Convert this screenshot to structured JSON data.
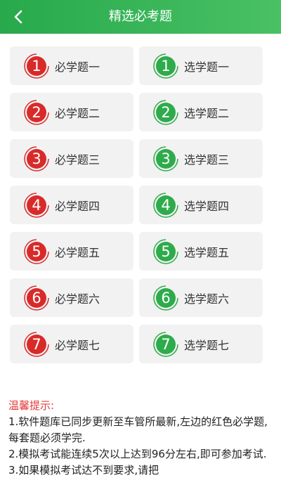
{
  "header": {
    "title": "精选必考题"
  },
  "required": [
    {
      "num": "1",
      "label": "必学题一"
    },
    {
      "num": "2",
      "label": "必学题二"
    },
    {
      "num": "3",
      "label": "必学题三"
    },
    {
      "num": "4",
      "label": "必学题四"
    },
    {
      "num": "5",
      "label": "必学题五"
    },
    {
      "num": "6",
      "label": "必学题六"
    },
    {
      "num": "7",
      "label": "必学题七"
    }
  ],
  "optional": [
    {
      "num": "1",
      "label": "选学题一"
    },
    {
      "num": "2",
      "label": "选学题二"
    },
    {
      "num": "3",
      "label": "选学题三"
    },
    {
      "num": "4",
      "label": "选学题四"
    },
    {
      "num": "5",
      "label": "选学题五"
    },
    {
      "num": "6",
      "label": "选学题六"
    },
    {
      "num": "7",
      "label": "选学题七"
    }
  ],
  "tips": {
    "title": "温馨提示:",
    "lines": [
      "1.软件题库已同步更新至车管所最新,左边的红色必学题,每套题必须学完.",
      "2.模拟考试能连续5次以上达到96分左右,即可参加考试.",
      "3.如果模拟考试达不到要求,请把"
    ]
  },
  "colors": {
    "required": "#d92a2a",
    "optional": "#2eab4b",
    "header": "#2fae4f"
  }
}
